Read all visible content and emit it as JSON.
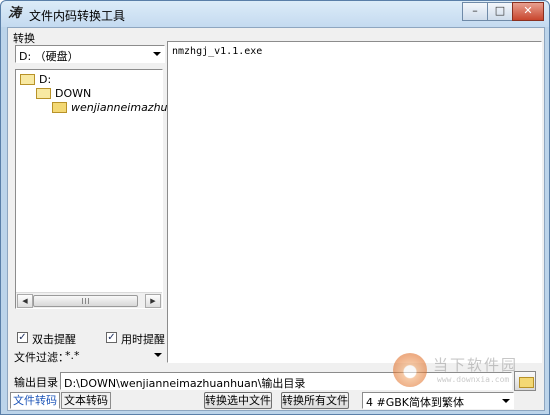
{
  "window": {
    "title": "文件内码转换工具",
    "app_icon": "涛",
    "minimize": "–",
    "maximize": "□",
    "close": "✕"
  },
  "menu": {
    "items": [
      "转换"
    ]
  },
  "drive": {
    "selected": "D: （硬盘）"
  },
  "tree": {
    "nodes": [
      "D:",
      "DOWN",
      "wenjianneimazhuanhu"
    ]
  },
  "files": {
    "items": [
      "nmzhgj_v1.1.exe"
    ]
  },
  "options": {
    "dblclick_label": "双击提醒",
    "dblclick_checked": true,
    "timed_label": "用时提醒",
    "timed_checked": true
  },
  "filter": {
    "label": "文件过滤：",
    "value": "*.*"
  },
  "output": {
    "label": "输出目录：",
    "path": "D:\\DOWN\\wenjianneimazhuanhuan\\输出目录"
  },
  "tabs": [
    "文件转码",
    "文本转码"
  ],
  "actions": {
    "convert_selected": "转换选中文件",
    "convert_all": "转换所有文件"
  },
  "mode": {
    "selected": "4 #GBK简体到繁体"
  },
  "watermark": {
    "text": "当下软件园",
    "url": "www.downxia.com"
  },
  "colors": {
    "active_tab": "#1c54b8",
    "title_grad_top": "#dcecf8"
  }
}
